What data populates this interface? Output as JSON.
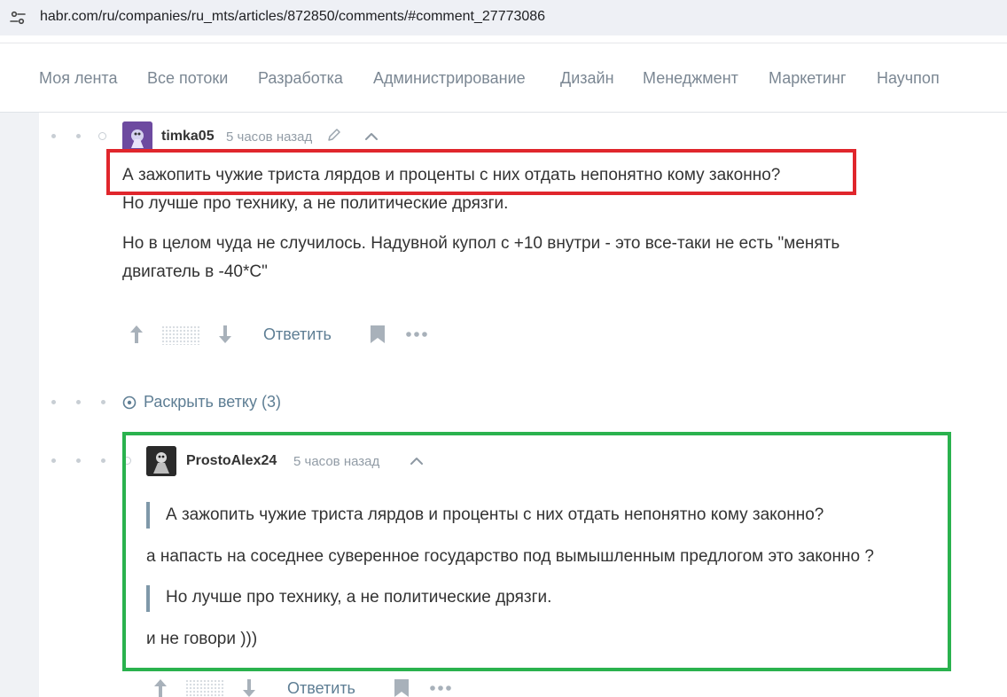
{
  "browser": {
    "url": "habr.com/ru/companies/ru_mts/articles/872850/comments/#comment_27773086"
  },
  "nav": {
    "items": [
      "Моя лента",
      "Все потоки",
      "Разработка",
      "Администрирование",
      "Дизайн",
      "Менеджмент",
      "Маркетинг",
      "Научпоп"
    ]
  },
  "comment1": {
    "username": "timka05",
    "time": "5 часов назад",
    "lines": [
      "А зажопить чужие триста лярдов и проценты с них отдать непонятно кому законно?",
      "Но лучше про технику, а не политические дрязги.",
      "Но в целом чуда не случилось. Надувной купол с +10 внутри - это все-таки не есть \"менять",
      "двигатель в -40*С\""
    ],
    "reply_label": "Ответить"
  },
  "expand_thread": {
    "label": "Раскрыть ветку (3)"
  },
  "comment2": {
    "username": "ProstoAlex24",
    "time": "5 часов назад",
    "quote1": "А зажопить чужие триста лярдов и проценты с них отдать непонятно кому законно?",
    "text1": "а напасть на соседнее суверенное государство под вымышленным предлогом это законно ?",
    "quote2": "Но лучше про технику, а не политические дрязги.",
    "text2": "и не говори )))",
    "reply_label": "Ответить"
  },
  "colors": {
    "highlight_red": "#e0262c",
    "highlight_green": "#2ab24e",
    "link": "#5e7e94"
  }
}
